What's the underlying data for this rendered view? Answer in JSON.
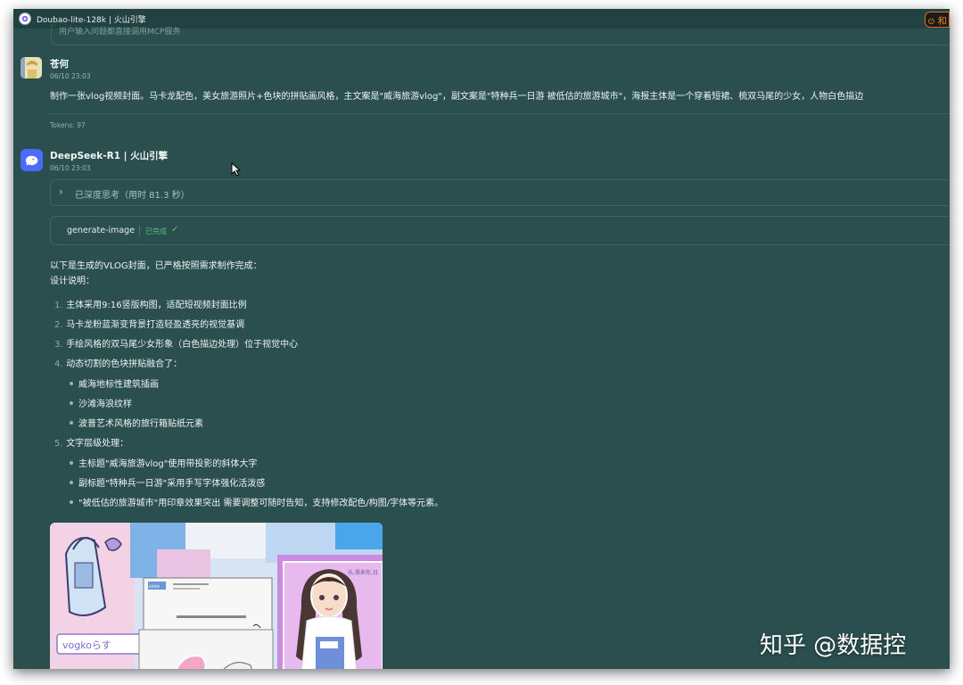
{
  "window": {
    "title": "Doubao-lite-128k | 火山引擎",
    "chip": "⊙ 和"
  },
  "previous": {
    "text": "用户输入问题都直接调用MCP服务"
  },
  "user_message": {
    "name": "苍何",
    "time": "06/10 23:03",
    "text": "制作一张vlog视频封面。马卡龙配色，美女旅游照片+色块的拼贴画风格，主文案是\"威海旅游vlog\"，副文案是\"特种兵一日游 被低估的旅游城市\"，海报主体是一个穿着短裙、梳双马尾的少女，人物白色描边",
    "tokens": "Tokens: 97"
  },
  "bot_message": {
    "name": "DeepSeek-R1 | 火山引擎",
    "time": "06/10 23:03",
    "thinking_label": "已深度思考（用时 81.3 秒）",
    "tool": {
      "name": "generate-image",
      "status": "已完成"
    },
    "intro": "以下是生成的VLOG封面，已严格按照需求制作完成：",
    "design_heading": "设计说明：",
    "items": [
      {
        "num": "1.",
        "text": "主体采用9:16竖版构图，适配短视频封面比例"
      },
      {
        "num": "2.",
        "text": "马卡龙粉蓝渐变背景打造轻盈透亮的视觉基调"
      },
      {
        "num": "3.",
        "text": "手绘风格的双马尾少女形象（白色描边处理）位于视觉中心"
      },
      {
        "num": "4.",
        "text": "动态切割的色块拼贴融合了："
      },
      {
        "num": "5.",
        "text": "文字层级处理："
      }
    ],
    "sub_items_4": [
      "威海地标性建筑插画",
      "沙滩海浪纹样",
      "波普艺术风格的旅行箱贴纸元素"
    ],
    "sub_items_5": [
      "主标题\"威海旅游vlog\"使用带投影的斜体大字",
      "副标题\"特种兵一日游\"采用手写字体强化活泼感",
      "\"被低估的旅游城市\"用印章效果突出 需要调整可随时告知，支持修改配色/构图/字体等元素。"
    ],
    "image": {
      "bag_text": "vogkoらす",
      "tag_text": "sinte",
      "stamp_text": "乐,得来你,日"
    }
  },
  "watermark": "知乎 @数据控",
  "colors": {
    "background": "#2b4f4f",
    "accent_green": "#54c277",
    "bot_avatar": "#4c6bfe"
  }
}
